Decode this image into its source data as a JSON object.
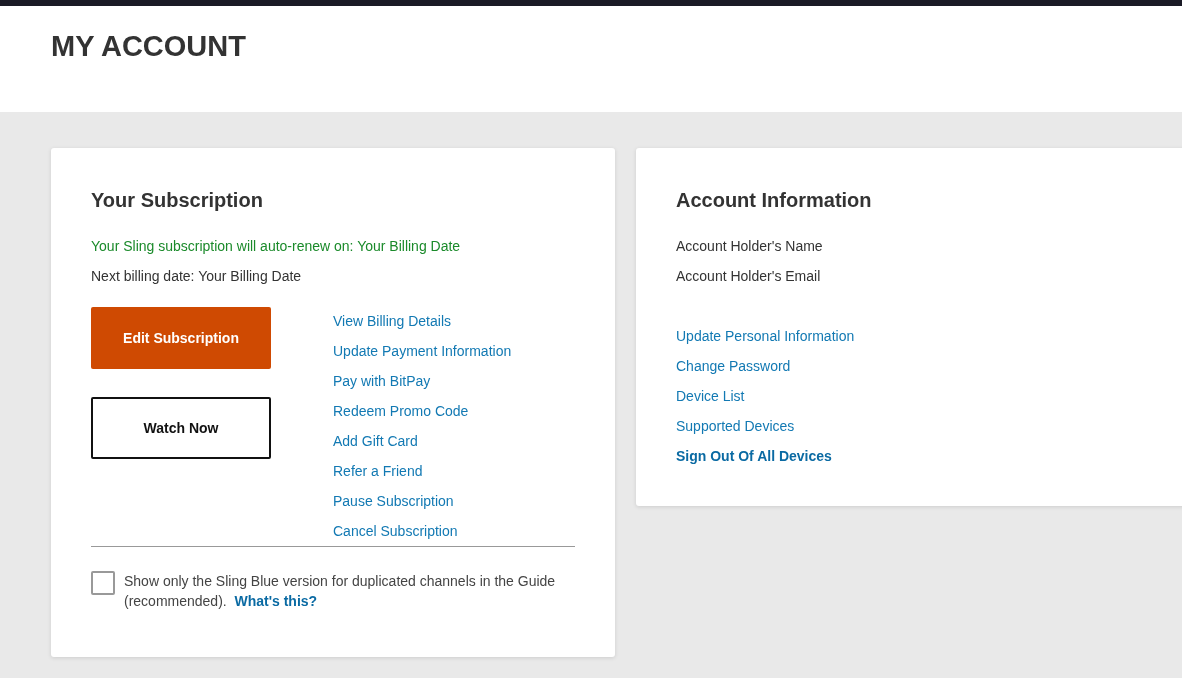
{
  "page_title": "MY ACCOUNT",
  "subscription": {
    "title": "Your Subscription",
    "renew_notice": "Your Sling subscription will auto-renew on: Your Billing Date",
    "next_billing": "Next billing date: Your Billing Date",
    "buttons": [
      {
        "label": "Edit Subscription",
        "kind": "primary"
      },
      {
        "label": "Watch Now",
        "kind": "secondary"
      }
    ],
    "links": [
      "View Billing Details",
      "Update Payment Information",
      "Pay with BitPay",
      "Redeem Promo Code",
      "Add Gift Card",
      "Refer a Friend",
      "Pause Subscription",
      "Cancel Subscription"
    ],
    "option": {
      "checked": false,
      "text": "Show only the Sling Blue version for duplicated channels in the Guide (recommended).",
      "link": "What's this?"
    }
  },
  "account": {
    "title": "Account Information",
    "details": [
      "Account Holder's Name",
      "Account Holder's Email"
    ],
    "links": [
      {
        "label": "Update Personal Information",
        "kind": "normal"
      },
      {
        "label": "Change Password",
        "kind": "normal"
      },
      {
        "label": "Device List",
        "kind": "normal"
      },
      {
        "label": "Supported Devices",
        "kind": "normal"
      },
      {
        "label": "Sign Out Of All Devices",
        "kind": "strong"
      }
    ]
  }
}
